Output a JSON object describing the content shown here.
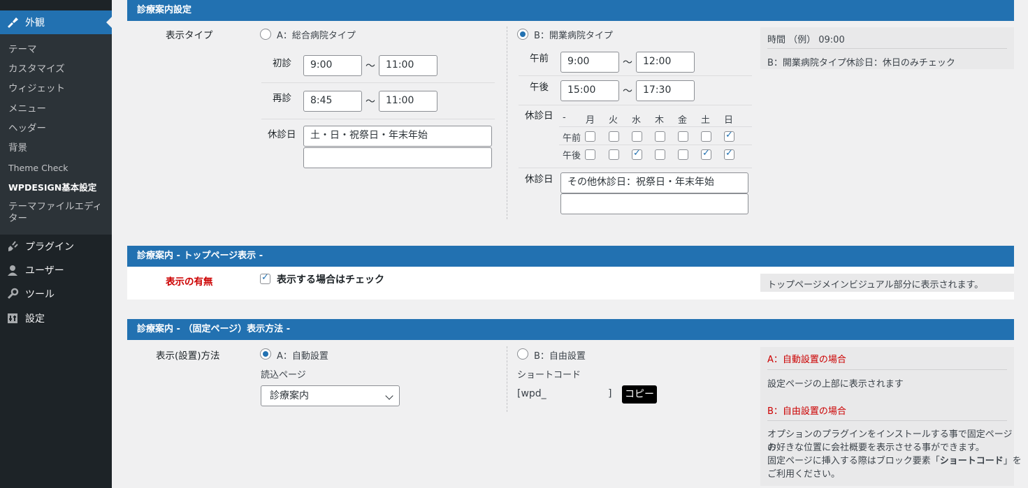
{
  "sidebar": {
    "active": {
      "label": "外観",
      "icon": "paintbrush-icon"
    },
    "submenu": [
      "テーマ",
      "カスタマイズ",
      "ウィジェット",
      "メニュー",
      "ヘッダー",
      "背景",
      "Theme Check",
      "WPDESIGN基本設定",
      "テーマファイルエディ ター"
    ],
    "main": [
      {
        "label": "プラグイン",
        "icon": "plugin-icon"
      },
      {
        "label": "ユーザー",
        "icon": "user-icon"
      },
      {
        "label": "ツール",
        "icon": "wrench-icon"
      },
      {
        "label": "設定",
        "icon": "settings-icon"
      }
    ]
  },
  "section1": {
    "title": "診療案内設定",
    "display_type_label": "表示タイプ",
    "typeA": {
      "radio_label": "A：総合病院タイプ",
      "first_label": "初診",
      "first_from": "9:00",
      "first_to": "11:00",
      "re_label": "再診",
      "re_from": "8:45",
      "re_to": "11:00",
      "closed_label": "休診日",
      "closed_1": "土・日・祝祭日・年末年始",
      "closed_2": ""
    },
    "typeB": {
      "radio_label": "B：開業病院タイプ",
      "am_label": "午前",
      "am_from": "9:00",
      "am_to": "12:00",
      "pm_label": "午後",
      "pm_from": "15:00",
      "pm_to": "17:30",
      "holiday_label": "休診日",
      "days": [
        "-",
        "月",
        "火",
        "水",
        "木",
        "金",
        "土",
        "日"
      ],
      "row_am": "午前",
      "row_pm": "午後",
      "am_checks": [
        false,
        false,
        false,
        false,
        false,
        false,
        true
      ],
      "pm_checks": [
        false,
        false,
        true,
        false,
        false,
        true,
        true
      ],
      "closed_label": "休診日",
      "closed_1": "その他休診日：祝祭日・年末年始",
      "closed_2": ""
    },
    "tilde": "〜",
    "info_1": "時間 （例） 09:00",
    "info_2": "B：開業病院タイプ休診日：休日のみチェック"
  },
  "section2": {
    "title": "診療案内 - トップページ表示 -",
    "label": "表示の有無",
    "checkbox_label": "表示する場合はチェック",
    "checked": true,
    "info": "トップページメインビジュアル部分に表示されます。"
  },
  "section3": {
    "title": "診療案内 - （固定ページ）表示方法 -",
    "label": "表示(設置)方法",
    "optionA": "A：自動設置",
    "load_page_label": "読込ページ",
    "selected_page": "診療案内",
    "optionB": "B：自由設置",
    "shortcode_label": "ショートコード",
    "shortcode_open": "[wpd_",
    "shortcode_close": "]",
    "copy_label": "コピー",
    "info_a_title": "A：自動設置の場合",
    "info_a_text": "設定ページの上部に表示されます",
    "info_b_title": "B：自由設置の場合",
    "info_b_line1": "オプションのプラグインをインストールする事で固定ページの",
    "info_b_line2": "お好きな位置に会社概要を表示させる事ができます。",
    "info_b_line3_pre": "固定ページに挿入する際はブロック要素「",
    "info_b_line3_bold": "ショートコード",
    "info_b_line3_post": "」を",
    "info_b_line4": "ご利用ください。"
  },
  "colors": {
    "accent": "#2271b1",
    "sidebar": "#1d2327",
    "red": "#cc0000"
  }
}
